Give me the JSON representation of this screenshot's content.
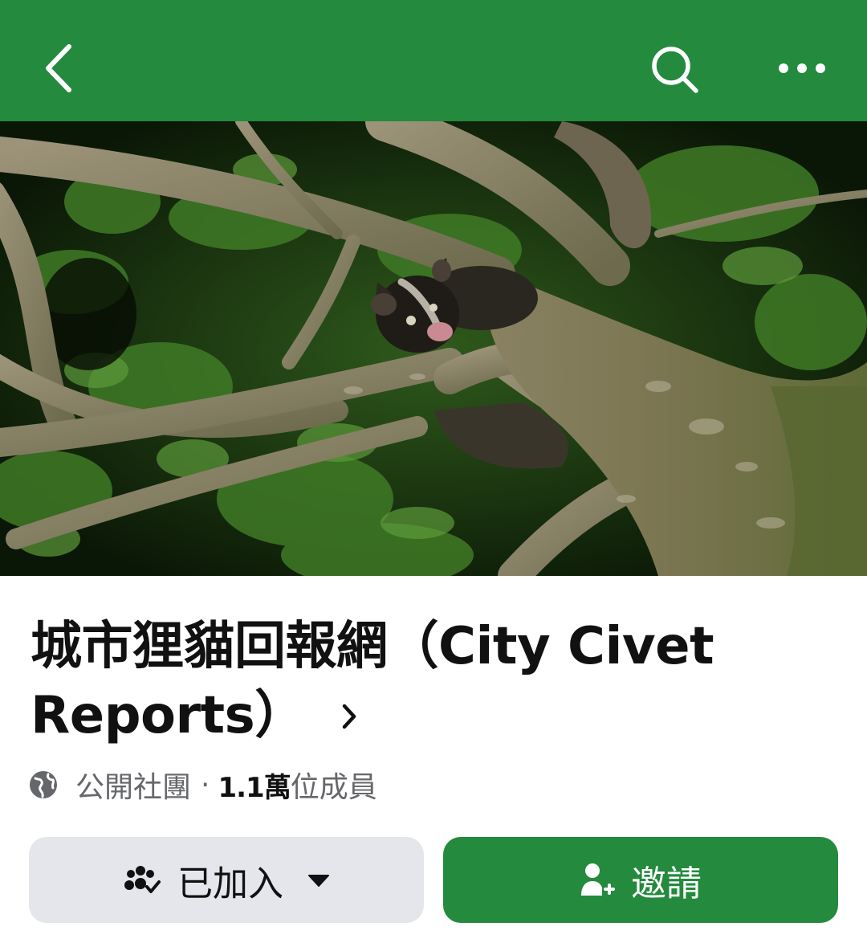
{
  "colors": {
    "brand": "#248a3d",
    "secondary_button": "#e4e6eb",
    "muted_text": "#65676b"
  },
  "header": {
    "back_icon": "chevron-left-icon",
    "search_icon": "search-icon",
    "more_icon": "more-horizontal-icon"
  },
  "group": {
    "name": "城市狸貓回報網（City Civet Reports）",
    "privacy_label": "公開社團",
    "separator": "·",
    "member_count": "1.1萬",
    "member_suffix": "位成員"
  },
  "actions": {
    "joined_label": "已加入",
    "invite_label": "邀請"
  }
}
